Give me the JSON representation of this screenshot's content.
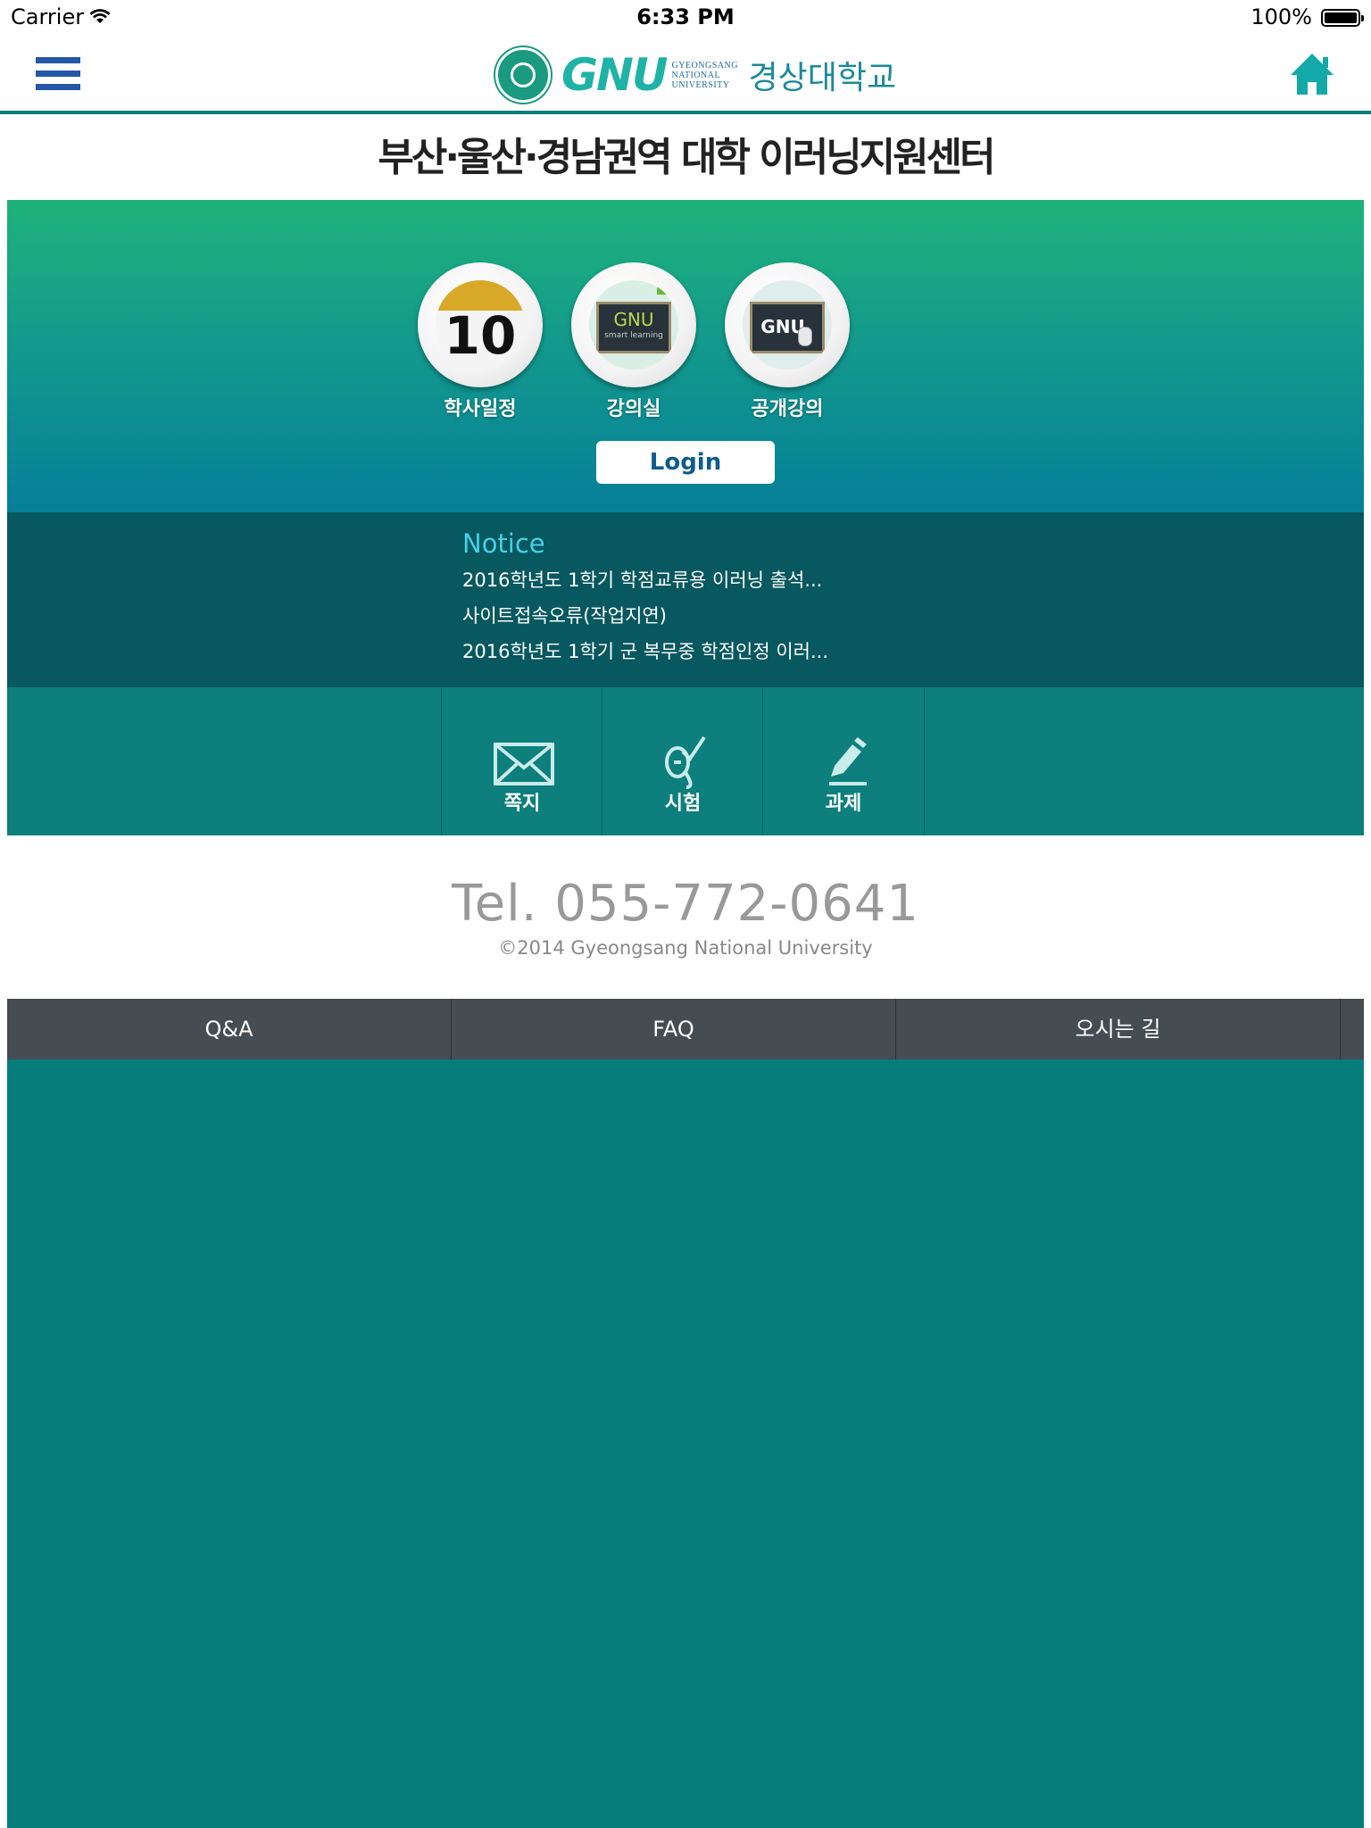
{
  "status_bar": {
    "carrier": "Carrier",
    "time": "6:33 PM",
    "battery": "100%"
  },
  "header": {
    "logo_gnu": "GNU",
    "logo_english": "GYEONGSANG NATIONAL UNIVERSITY",
    "logo_korean": "경상대학교"
  },
  "page_title": "부산·울산·경남권역 대학 이러닝지원센터",
  "hero": {
    "icons": [
      {
        "label": "학사일정",
        "icon": "calendar-icon",
        "number": "10"
      },
      {
        "label": "강의실",
        "icon": "blackboard-icon",
        "text": "GNU",
        "subtext": "smart learning"
      },
      {
        "label": "공개강의",
        "icon": "computer-board-icon",
        "text": "GNU"
      }
    ],
    "login_label": "Login"
  },
  "notice": {
    "title": "Notice",
    "items": [
      "2016학년도 1학기 학점교류용 이러닝 출석...",
      "사이트접속오류(작업지연)",
      "2016학년도 1학기 군 복무중 학점인정 이러..."
    ]
  },
  "quick_menu": [
    {
      "label": "쪽지",
      "icon": "envelope-icon"
    },
    {
      "label": "시험",
      "icon": "exam-check-icon"
    },
    {
      "label": "과제",
      "icon": "pencil-icon"
    }
  ],
  "contact": {
    "tel": "Tel. 055-772-0641",
    "copyright": "©2014 Gyeongsang National University"
  },
  "bottom_tabs": [
    "Q&A",
    "FAQ",
    "오시는 길"
  ],
  "colors": {
    "header_line": "#0d7f7d",
    "menu_icon": "#2457a6",
    "notice_bg": "#07585f",
    "quick_bg": "#0d7f7d",
    "bottom_bar": "#454c52"
  }
}
